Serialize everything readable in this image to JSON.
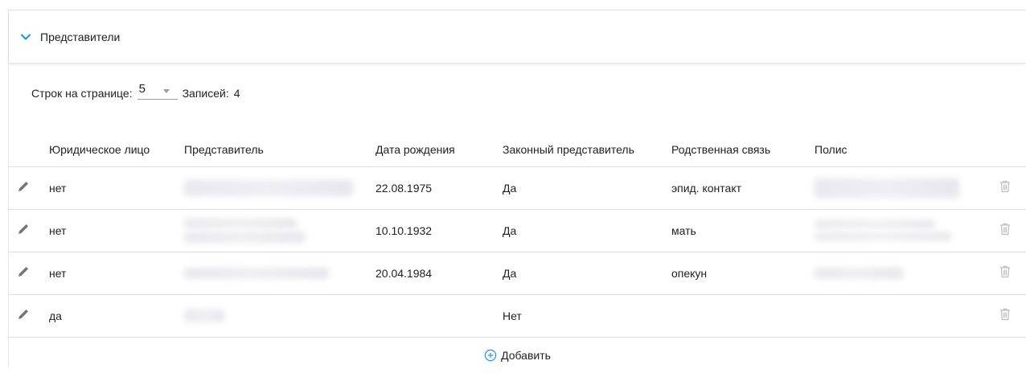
{
  "section": {
    "title": "Представители",
    "icon": "chevron-down-icon"
  },
  "pagination": {
    "rows_label": "Строк на странице:",
    "rows_value": "5",
    "records_label": "Записей:",
    "records_count": "4"
  },
  "table": {
    "headers": {
      "legal_entity": "Юридическое лицо",
      "representative": "Представитель",
      "birth_date": "Дата рождения",
      "legal_representative": "Законный представитель",
      "relationship": "Родственная связь",
      "policy": "Полис"
    },
    "rows": [
      {
        "legal_entity": "нет",
        "birth_date": "22.08.1975",
        "legal_representative": "Да",
        "relationship": "эпид. контакт"
      },
      {
        "legal_entity": "нет",
        "birth_date": "10.10.1932",
        "legal_representative": "Да",
        "relationship": "мать"
      },
      {
        "legal_entity": "нет",
        "birth_date": "20.04.1984",
        "legal_representative": "Да",
        "relationship": "опекун"
      },
      {
        "legal_entity": "да",
        "birth_date": "",
        "legal_representative": "Нет",
        "relationship": ""
      }
    ]
  },
  "add_button": {
    "label": "Добавить",
    "icon": "plus-circle-icon"
  },
  "colors": {
    "accent": "#2196f3",
    "icon_gray": "#9e9e9e",
    "border": "#e0e0e0"
  }
}
